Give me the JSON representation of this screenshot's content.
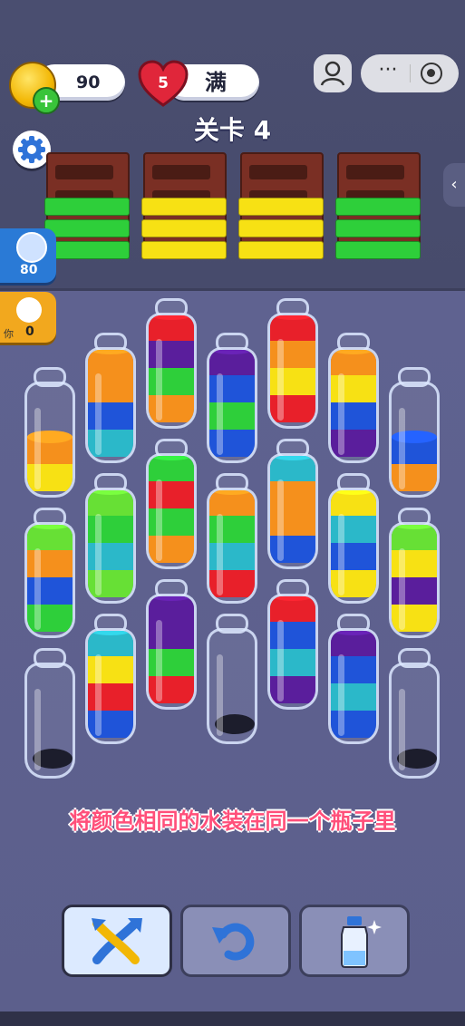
{
  "hud": {
    "coins": "90",
    "lives": "5",
    "lives_status": "满",
    "level_title": "关卡 4"
  },
  "leaderboard": {
    "opponent_score": "80",
    "you_label": "你",
    "you_score": "0"
  },
  "hint_text": "将颜色相同的水装在同一个瓶子里",
  "colors": {
    "R": "#e8202a",
    "O": "#f5901c",
    "Y": "#f7e114",
    "G": "#2ecf3a",
    "B": "#1f54d9",
    "C": "#2bb8c9",
    "P": "#5a1e9c",
    "L": "#67e035"
  },
  "crates": [
    {
      "boards": [
        "G",
        "G",
        "G"
      ]
    },
    {
      "boards": [
        "Y",
        "Y",
        "Y"
      ]
    },
    {
      "boards": [
        "Y",
        "Y",
        "Y"
      ]
    },
    {
      "boards": [
        "G",
        "G",
        "G"
      ]
    }
  ],
  "bottles": [
    {
      "layers": [
        "Y",
        "O"
      ]
    },
    {
      "layers": [
        "C",
        "B",
        "O",
        "O"
      ]
    },
    {
      "layers": [
        "O",
        "G",
        "P",
        "R"
      ]
    },
    {
      "layers": [
        "B",
        "G",
        "B",
        "P"
      ]
    },
    {
      "layers": [
        "R",
        "Y",
        "O",
        "R"
      ]
    },
    {
      "layers": [
        "P",
        "B",
        "Y",
        "O"
      ]
    },
    {
      "layers": [
        "O",
        "B"
      ]
    },
    {
      "layers": [
        "G",
        "B",
        "O",
        "L"
      ]
    },
    {
      "layers": [
        "L",
        "C",
        "G",
        "L"
      ]
    },
    {
      "layers": [
        "O",
        "G",
        "R",
        "G"
      ]
    },
    {
      "layers": [
        "R",
        "C",
        "G",
        "O"
      ]
    },
    {
      "layers": [
        "B",
        "O",
        "O",
        "C"
      ]
    },
    {
      "layers": [
        "Y",
        "B",
        "C",
        "Y"
      ]
    },
    {
      "layers": [
        "Y",
        "P",
        "Y",
        "L"
      ]
    },
    {
      "layers": []
    },
    {
      "layers": [
        "B",
        "R",
        "Y",
        "C"
      ]
    },
    {
      "layers": [
        "R",
        "G",
        "P",
        "P"
      ]
    },
    {
      "layers": []
    },
    {
      "layers": [
        "P",
        "C",
        "B",
        "R"
      ]
    },
    {
      "layers": [
        "B",
        "C",
        "B",
        "P"
      ]
    },
    {
      "layers": []
    }
  ],
  "toolbar": {
    "swap_icon": "swap-arrows-icon",
    "undo_icon": "undo-icon",
    "add_bottle_icon": "add-bottle-icon"
  }
}
